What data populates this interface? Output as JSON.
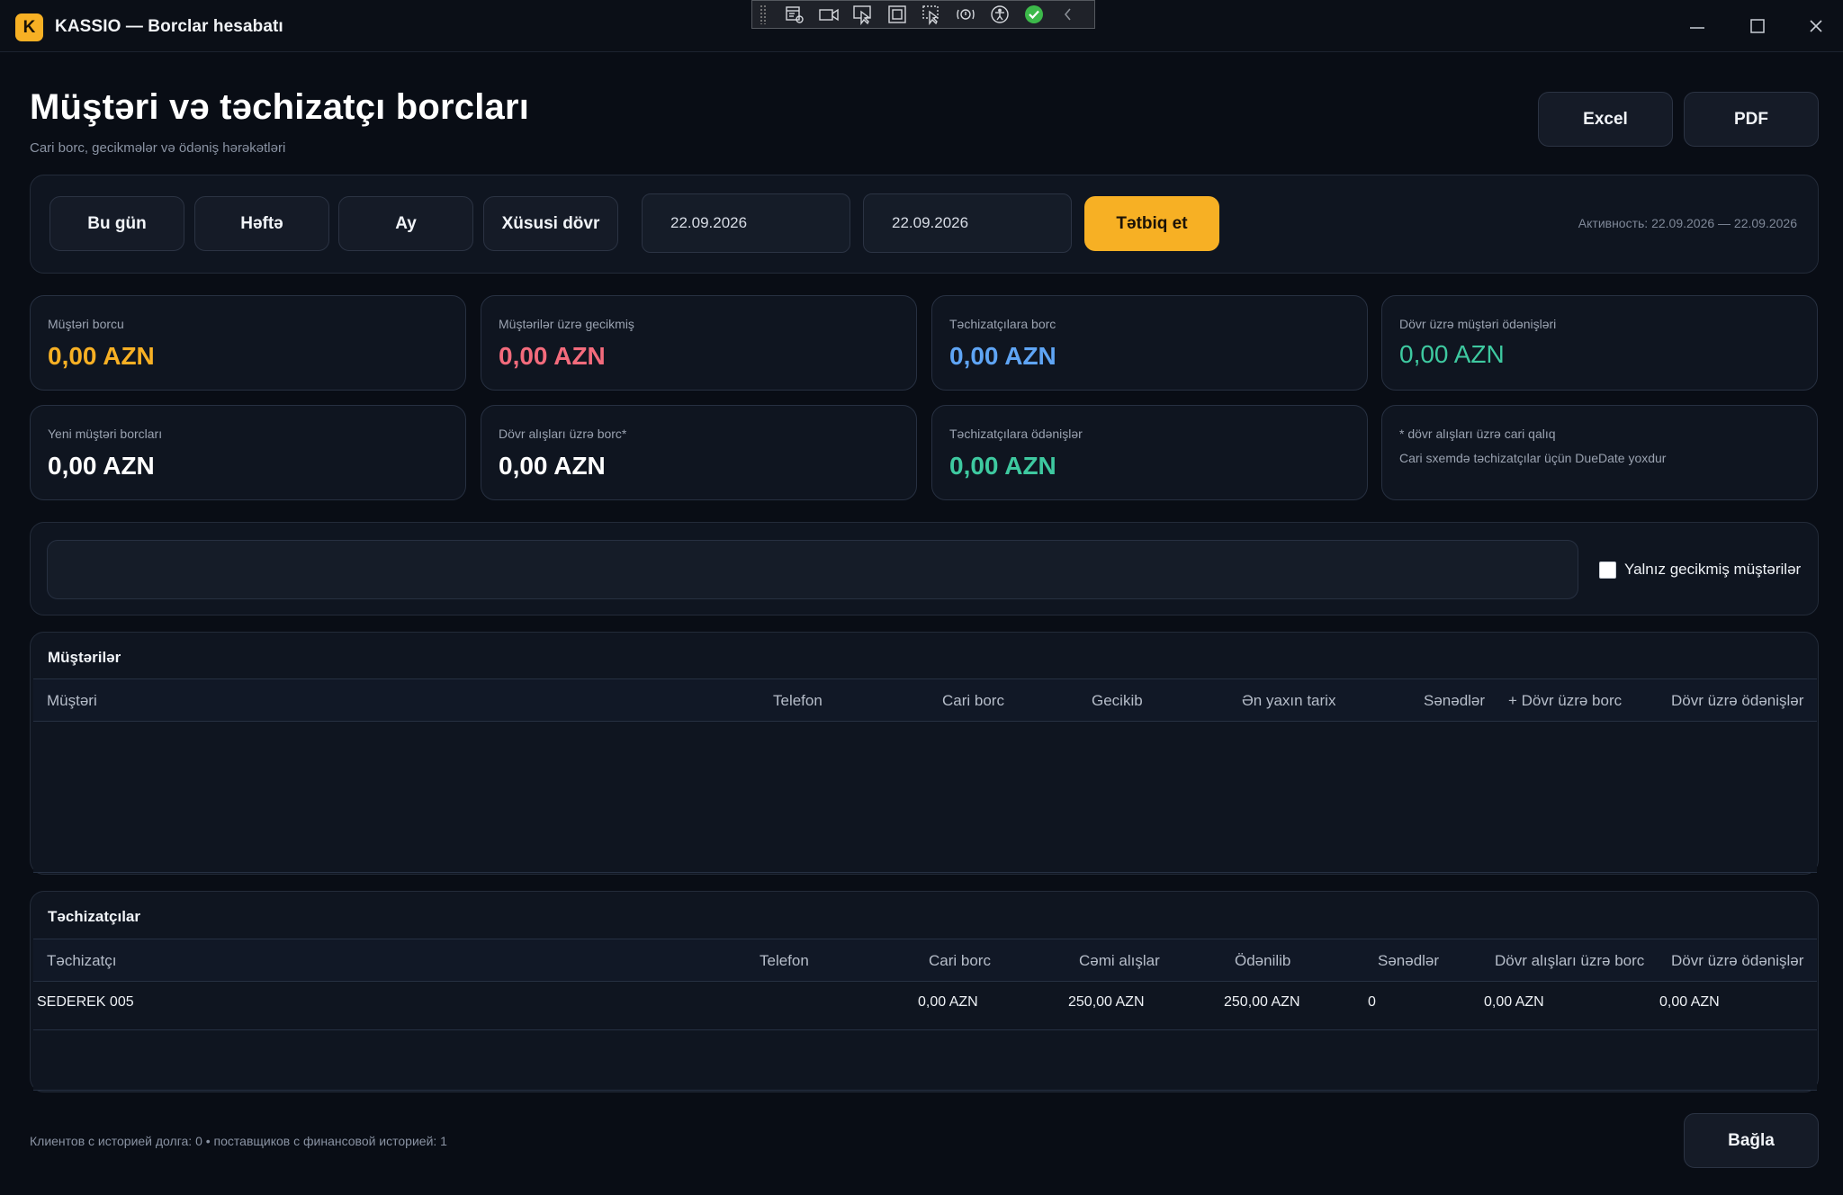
{
  "window": {
    "logo_letter": "K",
    "title": "KASSIO — Borclar hesabatı"
  },
  "header": {
    "title": "Müştəri və təchizatçı borcları",
    "subtitle": "Cari borc, gecikmələr və ödəniş hərəkətləri",
    "excel_label": "Excel",
    "pdf_label": "PDF"
  },
  "filters": {
    "today_label": "Bu gün",
    "week_label": "Həftə",
    "month_label": "Ay",
    "custom_label": "Xüsusi dövr",
    "date_from": "22.09.2026",
    "date_to": "22.09.2026",
    "apply_label": "Tətbiq et",
    "active_range": "Активность: 22.09.2026 — 22.09.2026"
  },
  "cards": {
    "customer_debt": {
      "label": "Müştəri borcu",
      "value": "0,00 AZN"
    },
    "customer_overdue": {
      "label": "Müştərilər üzrə gecikmiş",
      "value": "0,00 AZN"
    },
    "supplier_debt": {
      "label": "Təchizatçılara borc",
      "value": "0,00 AZN"
    },
    "period_customer_payments": {
      "label": "Dövr üzrə müştəri ödənişləri",
      "value": "0,00 AZN"
    },
    "new_customer_debts": {
      "label": "Yeni müştəri borcları",
      "value": "0,00 AZN"
    },
    "period_purchase_debt": {
      "label": "Dövr alışları üzrə borc*",
      "value": "0,00 AZN"
    },
    "supplier_payments": {
      "label": "Təchizatçılara ödənişlər",
      "value": "0,00 AZN"
    },
    "note": {
      "line1": "* dövr alışları üzrə cari qalıq",
      "line2": "Cari sxemdə təchizatçılar üçün DueDate yoxdur"
    }
  },
  "colors": {
    "accent": "#f7b024",
    "overdue": "#f36b7c",
    "supplier": "#5fa5f5",
    "payment": "#3ec9a0"
  },
  "search": {
    "value": "",
    "placeholder": "",
    "overdue_only_label": "Yalnız gecikmiş müştərilər"
  },
  "customers": {
    "title": "Müştərilər",
    "columns": [
      "Müştəri",
      "Telefon",
      "Cari borc",
      "Gecikib",
      "Ən yaxın tarix",
      "Sənədlər",
      "+ Dövr üzrə borc",
      "Dövr üzrə ödənişlər"
    ],
    "rows": []
  },
  "suppliers": {
    "title": "Təchizatçılar",
    "columns": [
      "Təchizatçı",
      "Telefon",
      "Cari borc",
      "Cəmi alışlar",
      "Ödənilib",
      "Sənədlər",
      "Dövr alışları üzrə borc",
      "Dövr üzrə ödənişlər"
    ],
    "rows": [
      [
        "SEDEREK 005",
        "",
        "0,00 AZN",
        "250,00 AZN",
        "250,00 AZN",
        "0",
        "0,00 AZN",
        "0,00 AZN"
      ]
    ]
  },
  "footer": {
    "summary": "Клиентов с историей долга: 0 • поставщиков с финансовой историей: 1",
    "close_label": "Bağla"
  }
}
